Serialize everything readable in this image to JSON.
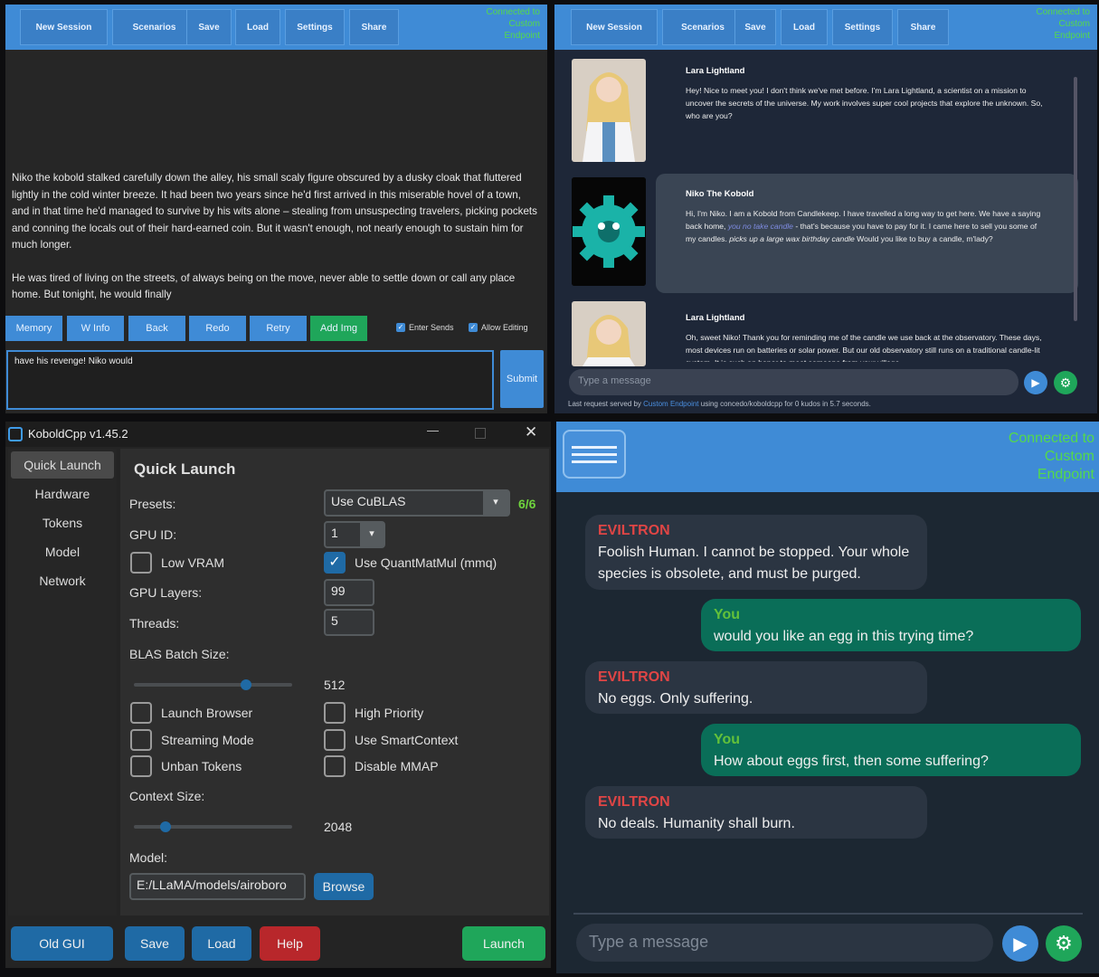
{
  "lite_nav": {
    "buttons": [
      "New Session",
      "Scenarios",
      "Save",
      "Load",
      "Settings",
      "Share"
    ],
    "connection": [
      "Connected to",
      "Custom",
      "Endpoint"
    ]
  },
  "story_panel": {
    "paragraphs": [
      "Niko the kobold stalked carefully down the alley, his small scaly figure obscured by a dusky cloak that fluttered lightly in the cold winter breeze. It had been two years since he'd first arrived in this miserable hovel of a town, and in that time he'd managed to survive by his wits alone – stealing from unsuspecting travelers, picking pockets and conning the locals out of their hard-earned coin. But it wasn't enough, not nearly enough to sustain him for much longer.",
      "He was tired of living on the streets, of always being on the move, never able to settle down or call any place home. But tonight, he would finally"
    ],
    "buttons": [
      "Memory",
      "W Info",
      "Back",
      "Redo",
      "Retry",
      "Add Img"
    ],
    "enter_sends": "Enter Sends",
    "allow_editing": "Allow Editing",
    "input_value": "have his revenge! Niko would",
    "submit": "Submit"
  },
  "chat_panel": {
    "messages": [
      {
        "name": "Lara Lightland",
        "text": "Hey! Nice to meet you! I don't think we've met before. I'm Lara Lightland, a scientist on a mission to uncover the secrets of the universe. My work involves super cool projects that explore the unknown. So, who are you?"
      },
      {
        "name": "Niko The Kobold",
        "text_a": "Hi, I'm Niko. I am a Kobold from Candlekeep. I have travelled a long way to get here. We have a saying back home, ",
        "text_b": "you no take candle",
        "text_c": " - that's because you have to pay for it. I came here to sell you some of my candles. ",
        "text_d": "picks up a large wax birthday candle",
        "text_e": " Would you like to buy a candle, m'lady?"
      },
      {
        "name": "Lara Lightland",
        "text": "Oh, sweet Niko! Thank you for reminding me of the candle we use back at the observatory. These days, most devices run on batteries or solar power. But our old observatory still runs on a traditional candle-lit system. It is such an honor to meet someone from your village."
      }
    ],
    "placeholder": "Type a message",
    "footer_a": "Last request served by ",
    "footer_b": "Custom Endpoint",
    "footer_c": " using concedo/koboldcpp for 0 kudos in 5.7 seconds."
  },
  "koboldcpp": {
    "title": "KoboldCpp v1.45.2",
    "sidebar": [
      "Quick Launch",
      "Hardware",
      "Tokens",
      "Model",
      "Network"
    ],
    "heading": "Quick Launch",
    "presets_label": "Presets:",
    "presets_value": "Use CuBLAS",
    "presets_count": "6/6",
    "gpu_id_label": "GPU ID:",
    "gpu_id_value": "1",
    "low_vram": "Low VRAM",
    "quantmatmul": "Use QuantMatMul (mmq)",
    "gpu_layers_label": "GPU Layers:",
    "gpu_layers_value": "99",
    "threads_label": "Threads:",
    "threads_value": "5",
    "blas_label": "BLAS Batch Size:",
    "blas_value": "512",
    "launch_browser": "Launch Browser",
    "high_priority": "High Priority",
    "streaming_mode": "Streaming Mode",
    "smart_context": "Use SmartContext",
    "unban_tokens": "Unban Tokens",
    "disable_mmap": "Disable MMAP",
    "context_label": "Context Size:",
    "context_value": "2048",
    "model_label": "Model:",
    "model_value": "E:/LLaMA/models/airoboro",
    "browse": "Browse",
    "bottom": {
      "old_gui": "Old GUI",
      "save": "Save",
      "load": "Load",
      "help": "Help",
      "launch": "Launch"
    }
  },
  "chat4": {
    "connection": [
      "Connected to",
      "Custom",
      "Endpoint"
    ],
    "messages": [
      {
        "name": "EVILTRON",
        "text": "Foolish Human. I cannot be stopped. Your whole species is obsolete, and must be purged."
      },
      {
        "name": "You",
        "text": "would you like an egg in this trying time?"
      },
      {
        "name": "EVILTRON",
        "text": "No eggs. Only suffering."
      },
      {
        "name": "You",
        "text": "How about eggs first, then some suffering?"
      },
      {
        "name": "EVILTRON",
        "text": "No deals. Humanity shall burn."
      }
    ],
    "placeholder": "Type a message"
  },
  "colors": {
    "accent": "#3f8bd6",
    "connected": "#54d94c",
    "add_img": "#1fa65a",
    "bot_name": "#e04545",
    "you_name": "#63c13a",
    "you_bubble": "#0a6e58"
  }
}
